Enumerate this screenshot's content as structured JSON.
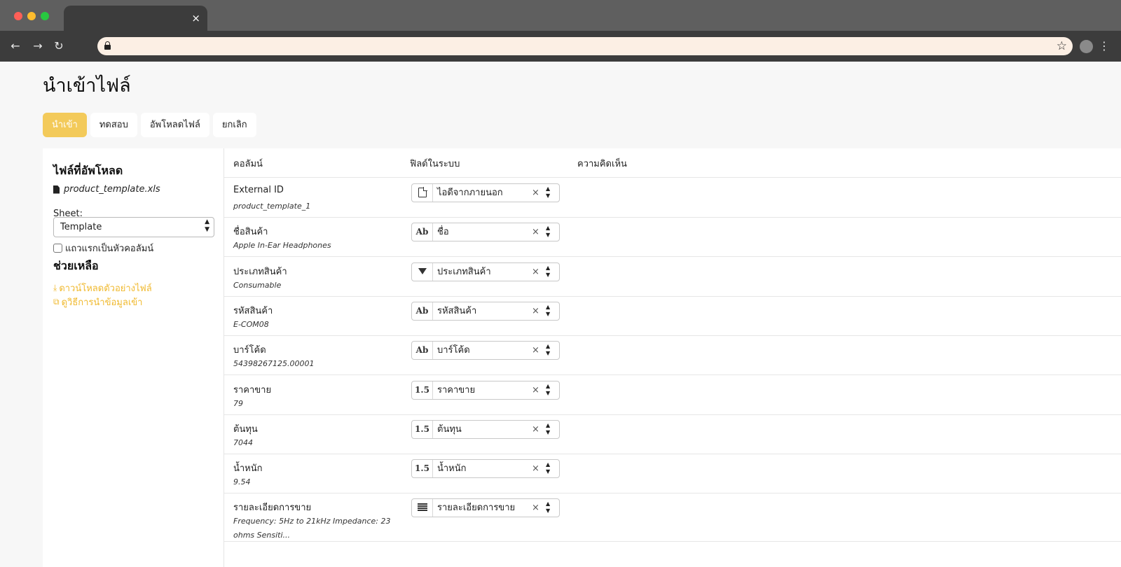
{
  "browser": {
    "tab_close": "×",
    "back": "←",
    "forward": "→",
    "reload": "↻",
    "star": "☆",
    "menu": "⋮"
  },
  "page": {
    "title": "นำเข้าไฟล์",
    "actions": {
      "import": "นำเข้า",
      "test": "ทดสอบ",
      "upload": "อัพโหลดไฟล์",
      "cancel": "ยกเลิก"
    }
  },
  "sidebar": {
    "uploaded_heading": "ไฟล์ที่อัพโหลด",
    "file_name": "product_template.xls",
    "sheet_label": "Sheet:",
    "sheet_value": "Template",
    "header_checkbox_label": "แถวแรกเป็นหัวคอลัมน์",
    "help_heading": "ช่วยเหลือ",
    "download_sample": "ดาวน์โหลดตัวอย่างไฟล์",
    "import_guide": "ดูวิธีการนำข้อมูลเข้า"
  },
  "table": {
    "headers": {
      "column": "คอลัมน์",
      "system_field": "ฟิลด์ในระบบ",
      "comment": "ความคิดเห็น"
    },
    "rows": [
      {
        "name": "External ID",
        "sample": "product_template_1",
        "icon": "document-icon",
        "icon_text": "",
        "field": "ไอดีจากภายนอก"
      },
      {
        "name": "ชื่อสินค้า",
        "sample": "Apple In-Ear Headphones",
        "icon": "text-type-icon",
        "icon_text": "Ab",
        "field": "ชื่อ"
      },
      {
        "name": "ประเภทสินค้า",
        "sample": "Consumable",
        "icon": "selection-type-icon",
        "icon_text": "",
        "field": "ประเภทสินค้า"
      },
      {
        "name": "รหัสสินค้า",
        "sample": "E-COM08",
        "icon": "text-type-icon",
        "icon_text": "Ab",
        "field": "รหัสสินค้า"
      },
      {
        "name": "บาร์โค้ด",
        "sample": "54398267125.00001",
        "icon": "text-type-icon",
        "icon_text": "Ab",
        "field": "บาร์โค้ด"
      },
      {
        "name": "ราคาขาย",
        "sample": "79",
        "icon": "float-type-icon",
        "icon_text": "1.5",
        "field": "ราคาขาย"
      },
      {
        "name": "ต้นทุน",
        "sample": "7044",
        "icon": "float-type-icon",
        "icon_text": "1.5",
        "field": "ต้นทุน"
      },
      {
        "name": "น้ำหนัก",
        "sample": "9.54",
        "icon": "float-type-icon",
        "icon_text": "1.5",
        "field": "น้ำหนัก"
      },
      {
        "name": "รายละเอียดการขาย",
        "sample": "Frequency: 5Hz to 21kHz Impedance: 23 ohms Sensiti...",
        "icon": "long-text-type-icon",
        "icon_text": "",
        "field": "รายละเอียดการขาย"
      }
    ],
    "clear_symbol": "×",
    "updown_symbol": "⌃⌄"
  },
  "colors": {
    "accent": "#f3ca5a",
    "link": "#f0b92e",
    "chrome": "#3c3c3c",
    "omnibox": "#fcefe4"
  }
}
